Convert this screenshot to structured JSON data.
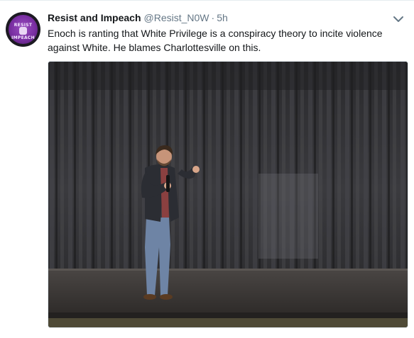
{
  "tweet": {
    "display_name": "Resist and Impeach",
    "handle": "@Resist_N0W",
    "separator": "·",
    "time": "5h",
    "text": "Enoch is ranting that White Privilege is a conspiracy theory to incite violence against White. He blames Charlottesville on this.",
    "avatar": {
      "line1": "RESIST",
      "line2": "IMPEACH"
    },
    "media": {
      "scene": "man speaking into microphone on stage in front of grey curtain"
    }
  },
  "icons": {
    "caret": "chevron-down-icon"
  },
  "colors": {
    "name": "#14171a",
    "muted": "#657786",
    "avatar_purple": "#7a2fa3"
  }
}
